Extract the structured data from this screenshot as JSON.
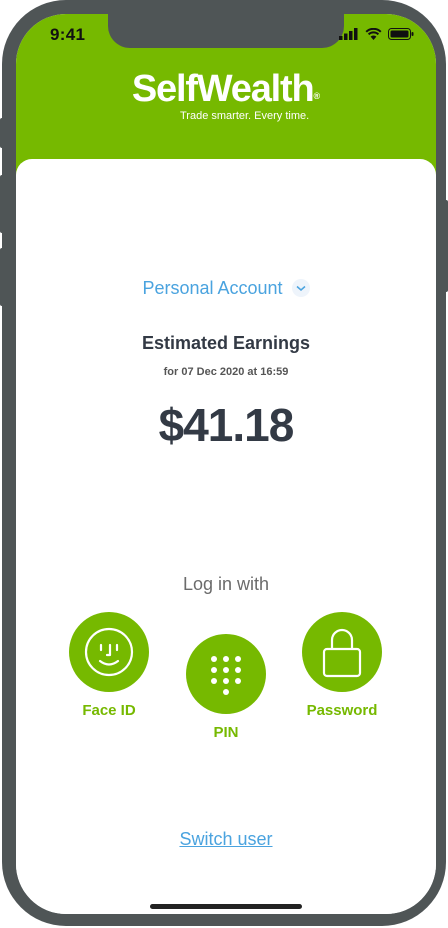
{
  "status_bar": {
    "time": "9:41"
  },
  "header": {
    "brand": "SelfWealth",
    "brand_mark": "®",
    "tagline": "Trade smarter. Every time."
  },
  "account": {
    "selector_label": "Personal Account"
  },
  "earnings": {
    "title": "Estimated Earnings",
    "date_line": "for 07 Dec 2020 at 16:59",
    "amount": "$41.18"
  },
  "login": {
    "prompt": "Log in with",
    "options": [
      {
        "label": "Face ID",
        "icon": "face-id-icon"
      },
      {
        "label": "PIN",
        "icon": "keypad-icon"
      },
      {
        "label": "Password",
        "icon": "lock-icon"
      }
    ]
  },
  "footer": {
    "switch_user": "Switch user"
  },
  "colors": {
    "brand_green": "#76b900",
    "link_blue": "#4aa3df",
    "text_dark": "#333a45"
  }
}
